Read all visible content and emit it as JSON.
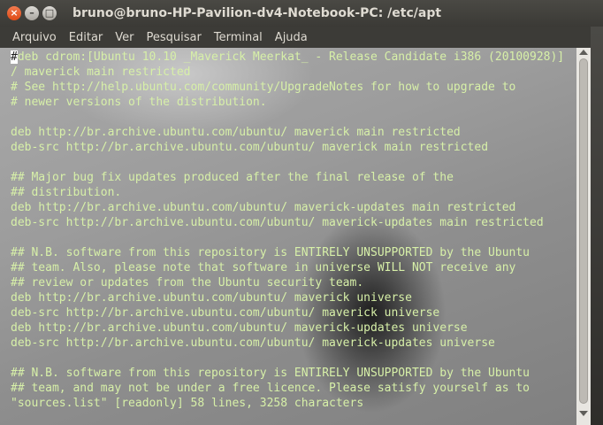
{
  "window": {
    "title": "bruno@bruno-HP-Pavilion-dv4-Notebook-PC: /etc/apt",
    "close_glyph": "×",
    "minimize_glyph": "–",
    "maximize_glyph": "□"
  },
  "menu": [
    "Arquivo",
    "Editar",
    "Ver",
    "Pesquisar",
    "Terminal",
    "Ajuda"
  ],
  "terminal": {
    "cursor_char": "#",
    "first_line_rest": "deb cdrom:[Ubuntu 10.10 _Maverick Meerkat_ - Release Candidate i386 (20100928)]",
    "lines": [
      "/ maverick main restricted",
      "# See http://help.ubuntu.com/community/UpgradeNotes for how to upgrade to",
      "# newer versions of the distribution.",
      "",
      "deb http://br.archive.ubuntu.com/ubuntu/ maverick main restricted",
      "deb-src http://br.archive.ubuntu.com/ubuntu/ maverick main restricted",
      "",
      "## Major bug fix updates produced after the final release of the",
      "## distribution.",
      "deb http://br.archive.ubuntu.com/ubuntu/ maverick-updates main restricted",
      "deb-src http://br.archive.ubuntu.com/ubuntu/ maverick-updates main restricted",
      "",
      "## N.B. software from this repository is ENTIRELY UNSUPPORTED by the Ubuntu",
      "## team. Also, please note that software in universe WILL NOT receive any",
      "## review or updates from the Ubuntu security team.",
      "deb http://br.archive.ubuntu.com/ubuntu/ maverick universe",
      "deb-src http://br.archive.ubuntu.com/ubuntu/ maverick universe",
      "deb http://br.archive.ubuntu.com/ubuntu/ maverick-updates universe",
      "deb-src http://br.archive.ubuntu.com/ubuntu/ maverick-updates universe",
      "",
      "## N.B. software from this repository is ENTIRELY UNSUPPORTED by the Ubuntu",
      "## team, and may not be under a free licence. Please satisfy yourself as to",
      "\"sources.list\" [readonly] 58 lines, 3258 characters"
    ],
    "text_color": "#d7f0a8"
  }
}
